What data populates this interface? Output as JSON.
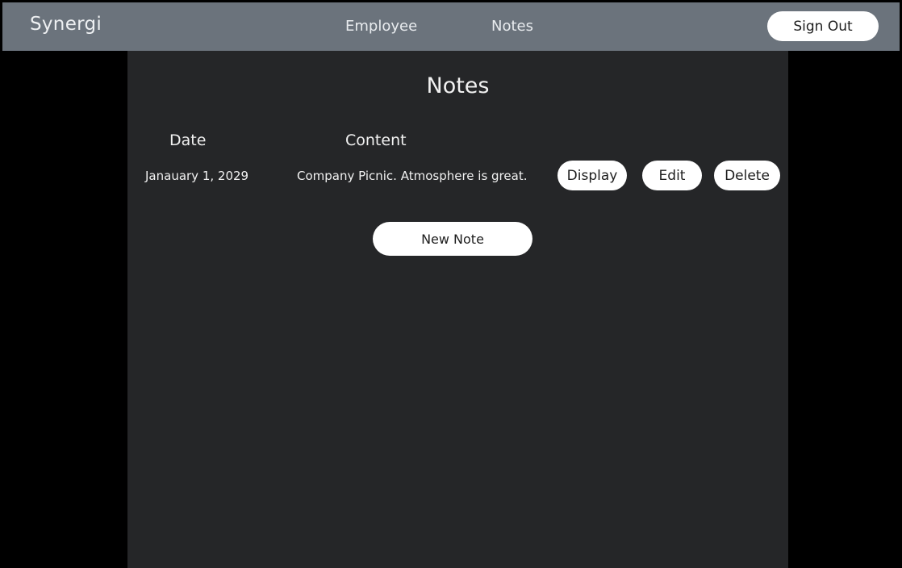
{
  "header": {
    "brand": "Synergi",
    "nav": [
      {
        "label": "Employee"
      },
      {
        "label": "Notes"
      }
    ],
    "sign_out_label": "Sign Out"
  },
  "main": {
    "title": "Notes",
    "columns": {
      "date": "Date",
      "content": "Content"
    },
    "rows": [
      {
        "date": "Janauary 1, 2029",
        "content": "Company Picnic. Atmosphere is great.",
        "actions": {
          "display": "Display",
          "edit": "Edit",
          "delete": "Delete"
        }
      }
    ],
    "new_note_label": "New Note"
  },
  "colors": {
    "header_bg": "#6b737c",
    "panel_bg": "#252628",
    "page_bg": "#000000",
    "button_bg": "#ffffff"
  }
}
